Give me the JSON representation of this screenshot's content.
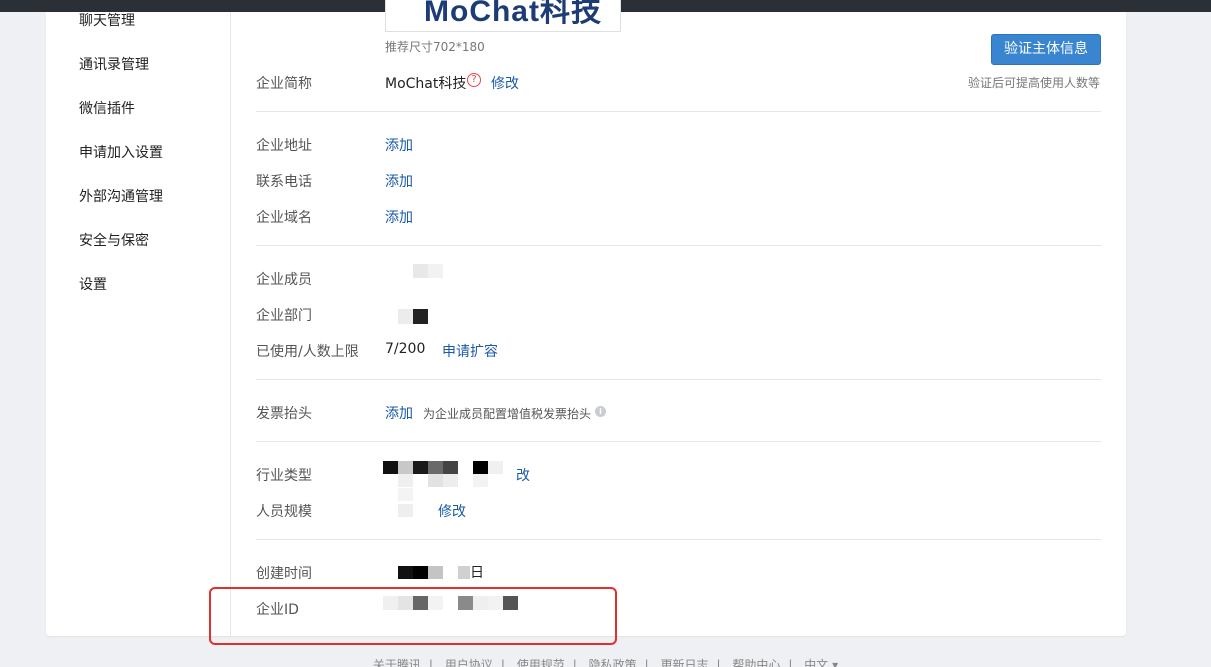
{
  "sidebar": {
    "items": [
      {
        "label": "聊天管理"
      },
      {
        "label": "通讯录管理"
      },
      {
        "label": "微信插件"
      },
      {
        "label": "申请加入设置"
      },
      {
        "label": "外部沟通管理"
      },
      {
        "label": "安全与保密"
      },
      {
        "label": "设置"
      }
    ]
  },
  "logo": {
    "text": "MoChat科技",
    "size_hint": "推荐尺寸702*180"
  },
  "verify": {
    "button_label": "验证主体信息",
    "hint": "验证后可提高使用人数等"
  },
  "fields": {
    "short_name": {
      "label": "企业简称",
      "value": "MoChat科技",
      "action": "修改"
    },
    "address": {
      "label": "企业地址",
      "action": "添加"
    },
    "phone": {
      "label": "联系电话",
      "action": "添加"
    },
    "domain": {
      "label": "企业域名",
      "action": "添加"
    },
    "members": {
      "label": "企业成员"
    },
    "departments": {
      "label": "企业部门"
    },
    "usage": {
      "label": "已使用/人数上限",
      "value": "7/200",
      "action": "申请扩容"
    },
    "invoice": {
      "label": "发票抬头",
      "action": "添加",
      "hint": "为企业成员配置增值税发票抬头"
    },
    "industry": {
      "label": "行业类型",
      "action": "改"
    },
    "scale": {
      "label": "人员规模",
      "action": "修改"
    },
    "created": {
      "label": "创建时间",
      "suffix": "日"
    },
    "corp_id": {
      "label": "企业ID"
    }
  },
  "footer": {
    "links": [
      "关于腾讯",
      "用户协议",
      "使用规范",
      "隐私政策",
      "更新日志",
      "帮助中心",
      "中文 ▾"
    ],
    "separator": "|"
  },
  "colors": {
    "link": "#1a5aa8",
    "button": "#3a85d0",
    "highlight_box": "#e03030"
  }
}
